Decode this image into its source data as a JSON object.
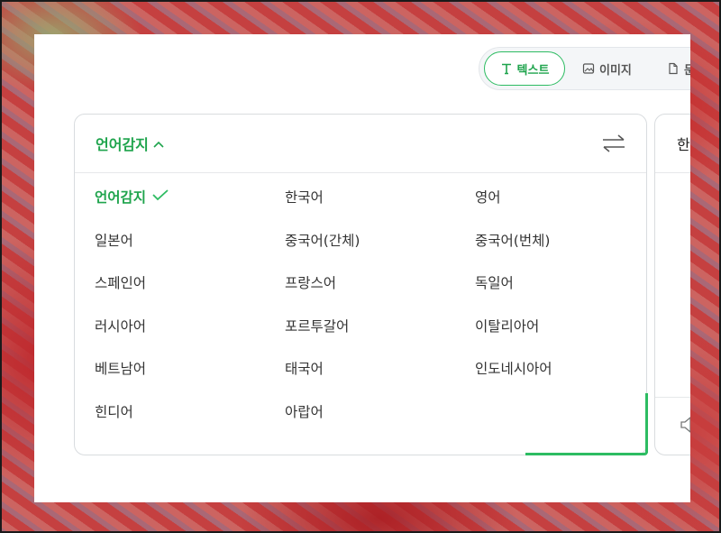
{
  "tabs": [
    {
      "label": "텍스트",
      "icon": "text-icon",
      "active": true
    },
    {
      "label": "이미지",
      "icon": "image-icon",
      "active": false
    },
    {
      "label": "문",
      "icon": "document-icon",
      "active": false
    }
  ],
  "source": {
    "detect_label": "언어감지",
    "languages": [
      {
        "label": "언어감지",
        "selected": true
      },
      {
        "label": "한국어"
      },
      {
        "label": "영어"
      },
      {
        "label": "일본어"
      },
      {
        "label": "중국어(간체)"
      },
      {
        "label": "중국어(번체)"
      },
      {
        "label": "스페인어"
      },
      {
        "label": "프랑스어"
      },
      {
        "label": "독일어"
      },
      {
        "label": "러시아어"
      },
      {
        "label": "포르투갈어"
      },
      {
        "label": "이탈리아어"
      },
      {
        "label": "베트남어"
      },
      {
        "label": "태국어"
      },
      {
        "label": "인도네시아어"
      },
      {
        "label": "힌디어"
      },
      {
        "label": "아랍어"
      }
    ]
  },
  "target": {
    "lang_label": "한"
  },
  "colors": {
    "accent": "#1fa44d",
    "border": "#d9dcdf"
  }
}
